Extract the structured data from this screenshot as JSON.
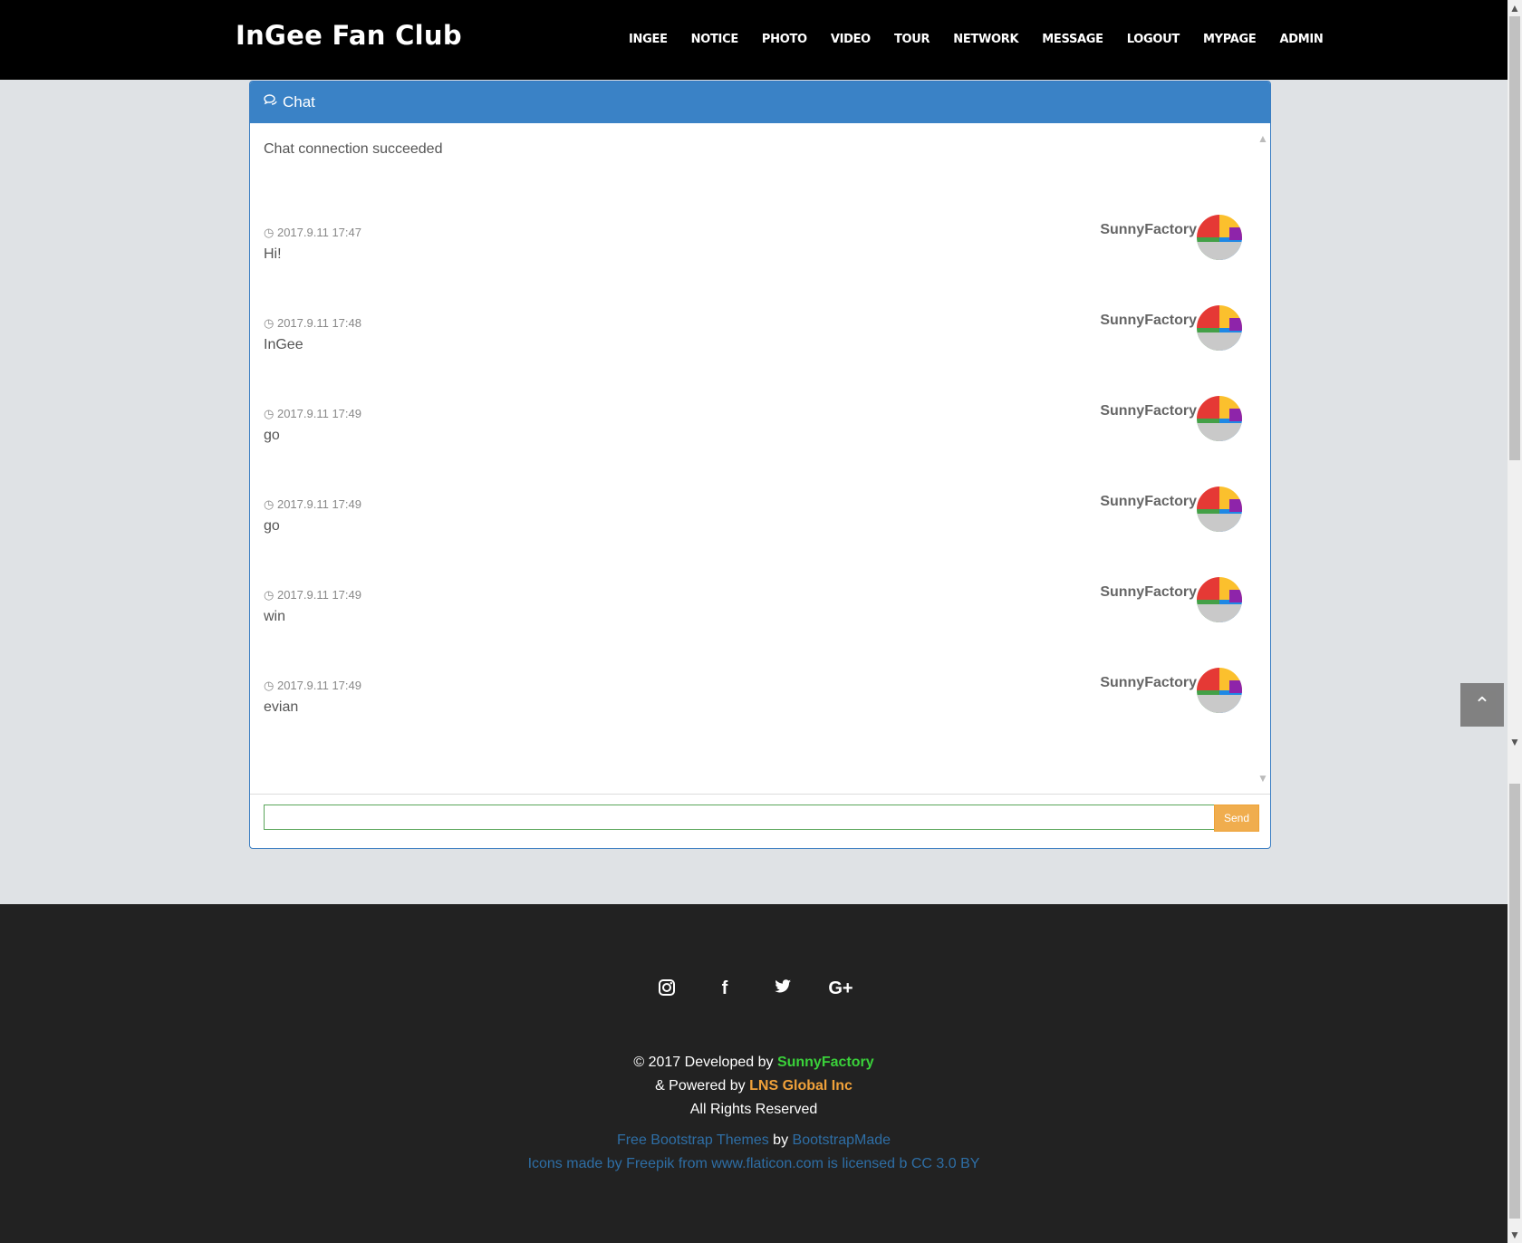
{
  "header": {
    "brand": "InGee Fan Club",
    "nav": [
      "INGEE",
      "NOTICE",
      "PHOTO",
      "VIDEO",
      "TOUR",
      "NETWORK",
      "MESSAGE",
      "LOGOUT",
      "MYPAGE",
      "ADMIN"
    ]
  },
  "chat": {
    "title": "Chat",
    "status": "Chat connection succeeded",
    "messages": [
      {
        "time": "2017.9.11 17:47",
        "text": "Hi!",
        "user": "SunnyFactory"
      },
      {
        "time": "2017.9.11 17:48",
        "text": "InGee",
        "user": "SunnyFactory"
      },
      {
        "time": "2017.9.11 17:49",
        "text": "go",
        "user": "SunnyFactory"
      },
      {
        "time": "2017.9.11 17:49",
        "text": "go",
        "user": "SunnyFactory"
      },
      {
        "time": "2017.9.11 17:49",
        "text": "win",
        "user": "SunnyFactory"
      },
      {
        "time": "2017.9.11 17:49",
        "text": "evian",
        "user": "SunnyFactory"
      }
    ],
    "input_value": "",
    "send_label": "Send"
  },
  "icons": {
    "chat": "chat-bubbles-icon",
    "clock": "clock-icon",
    "to_top": "chevron-up-icon",
    "social": [
      "instagram-icon",
      "facebook-icon",
      "twitter-icon",
      "google-plus-icon"
    ]
  },
  "footer": {
    "copyright_prefix": "© 2017 Developed by",
    "developer": "SunnyFactory",
    "powered_prefix": "& Powered by",
    "powered_by": "LNS Global Inc",
    "rights": "All Rights Reserved",
    "themes_link": "Free Bootstrap Themes",
    "by": "by",
    "bootstrapmade": "BootstrapMade",
    "icons_credit": "Icons made by Freepik from www.flaticon.com is licensed b CC 3.0 BY"
  },
  "colors": {
    "navbar": "#000000",
    "panel_header": "#3a82c6",
    "send_button": "#f0ad4e",
    "footer": "#222222",
    "developer_green": "#3ad13a",
    "powered_orange": "#f0a13a",
    "link_blue": "#2e6ea5"
  }
}
